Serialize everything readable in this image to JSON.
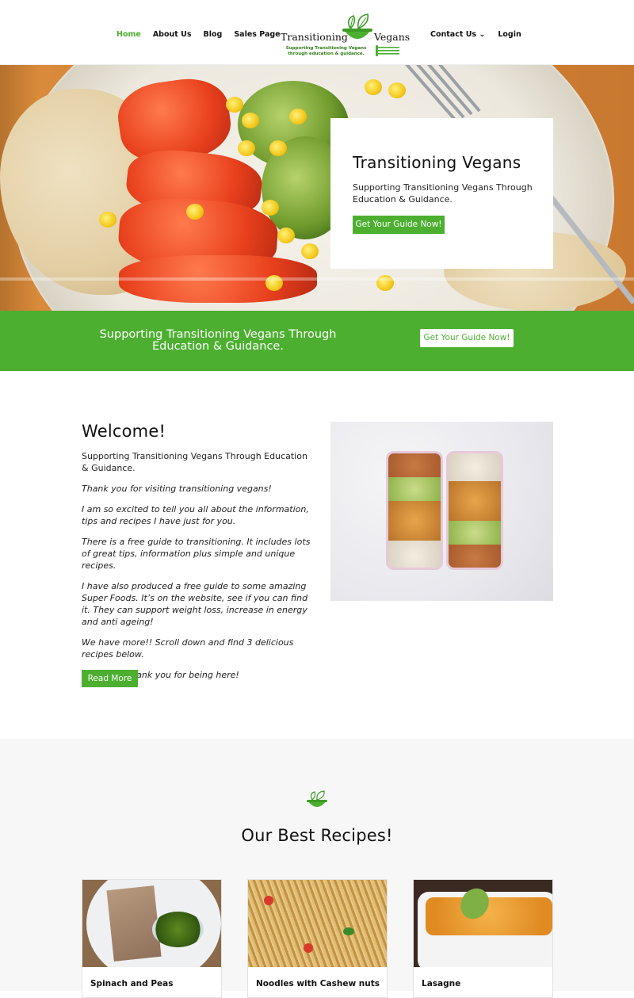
{
  "nav": {
    "left": [
      "Home",
      "About Us",
      "Blog",
      "Sales Page"
    ],
    "right": [
      "Contact Us ⌄",
      "Login"
    ],
    "active": "Home"
  },
  "logo": {
    "word1": "Transitioning",
    "word2": "Vegans",
    "tagline1": "Supporting Transitioning Vegans",
    "tagline2": "through education & guidance."
  },
  "hero": {
    "title": "Transitioning Vegans",
    "subtitle": "Supporting Transitioning Vegans Through Education & Guidance.",
    "button": "Get Your Guide Now!"
  },
  "band": {
    "text": "Supporting Transitioning Vegans Through Education & Guidance.",
    "button": "Get Your Guide Now!"
  },
  "welcome": {
    "title": "Welcome!",
    "intro": "Supporting Transitioning Vegans Through Education & Guidance.",
    "p1": "Thank you for visiting transitioning vegans!",
    "p2": "I am so excited to tell you all about the information, tips and recipes I have just for you.",
    "p3": "There is a free guide to transitioning. It includes lots of great tips, information plus simple and unique recipes.",
    "p4": "I have also produced a free guide to some amazing Super Foods. It’s on the website, see if you can find it. They can support weight loss, increase in energy and anti ageing!",
    "p5": "We have more!! Scroll down and find 3 delicious recipes below.",
    "p6": "Enjoy and thank you for being here!",
    "button": "Read More"
  },
  "recipes": {
    "title": "Our Best Recipes!",
    "items": [
      {
        "label": "Spinach and Peas"
      },
      {
        "label": "Noodles with Cashew nuts"
      },
      {
        "label": "Lasagne"
      }
    ]
  },
  "colors": {
    "accent": "#4caf30",
    "text": "#111111",
    "section_bg": "#f7f7f7"
  }
}
